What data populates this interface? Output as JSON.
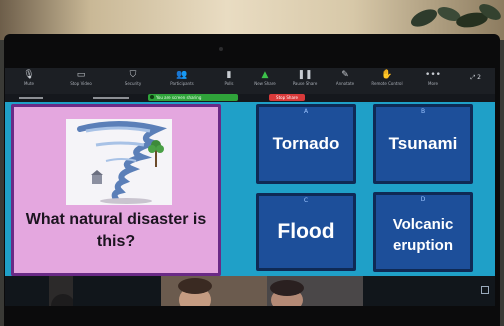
{
  "toolbar": {
    "buttons": [
      {
        "id": "mute",
        "icon": "microphone-icon",
        "label": "Mute"
      },
      {
        "id": "video",
        "icon": "video-camera-icon",
        "label": "Stop Video"
      },
      {
        "id": "security",
        "icon": "shield-icon",
        "label": "Security"
      },
      {
        "id": "participants",
        "icon": "participants-icon",
        "label": "Participants"
      },
      {
        "id": "polls",
        "icon": "bar-chart-icon",
        "label": "Polls"
      },
      {
        "id": "new_share",
        "icon": "share-screen-icon",
        "label": "New Share"
      },
      {
        "id": "pause_share",
        "icon": "pause-icon",
        "label": "Pause Share"
      },
      {
        "id": "annotate",
        "icon": "pencil-icon",
        "label": "Annotate"
      },
      {
        "id": "remote_control",
        "icon": "remote-control-icon",
        "label": "Remote Control"
      },
      {
        "id": "more",
        "icon": "more-icon",
        "label": "More"
      }
    ],
    "corner_text": "⤢ 2"
  },
  "status": {
    "sharing_text": "You are screen sharing",
    "stop_share_label": "Stop Share"
  },
  "question": {
    "text": "What natural disaster is this?"
  },
  "answers": [
    {
      "letter": "A",
      "text": "Tornado"
    },
    {
      "letter": "B",
      "text": "Tsunami"
    },
    {
      "letter": "C",
      "text": "Flood"
    },
    {
      "letter": "D",
      "text": "Volcanic eruption"
    }
  ],
  "colors": {
    "game_background": "#1fa0c8",
    "question_card": "#e4a7df",
    "answer_card": "#1d4f9a",
    "sharing_indicator": "#2fa33a",
    "stop_share": "#d93a3a"
  }
}
